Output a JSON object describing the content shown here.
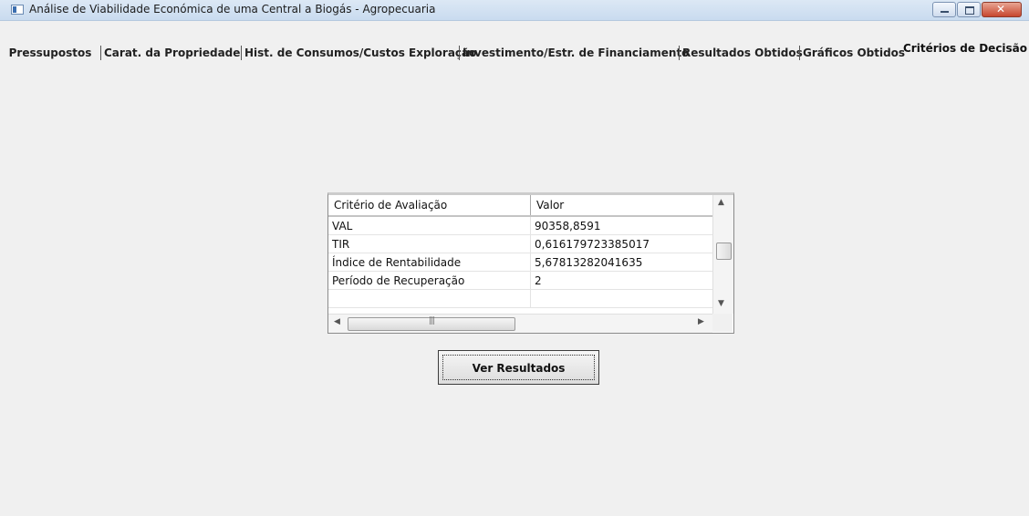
{
  "window": {
    "title": "Análise de Viabilidade Económica de uma Central a Biogás - Agropecuaria"
  },
  "tabs": [
    {
      "label": "Pressupostos"
    },
    {
      "label": "Carat. da Propriedade"
    },
    {
      "label": "Hist. de Consumos/Custos Exploração"
    },
    {
      "label": "Investimento/Estr. de Financiamento"
    },
    {
      "label": "Resultados Obtidos"
    },
    {
      "label": "Gráficos Obtidos"
    },
    {
      "label": "Critérios de Decisão",
      "selected": true
    }
  ],
  "grid": {
    "columns": [
      "Critério de Avaliação",
      "Valor"
    ],
    "rows": [
      {
        "criterio": "VAL",
        "valor": "90358,8591"
      },
      {
        "criterio": "TIR",
        "valor": "0,616179723385017"
      },
      {
        "criterio": "Índice de Rentabilidade",
        "valor": "5,67813282041635"
      },
      {
        "criterio": "Período de Recuperação",
        "valor": "2"
      }
    ]
  },
  "actions": {
    "ver_resultados_label": "Ver Resultados"
  },
  "icons": {
    "app": "app-window-icon",
    "minimize": "minimize-icon",
    "maximize": "maximize-icon",
    "close": "close-icon"
  }
}
